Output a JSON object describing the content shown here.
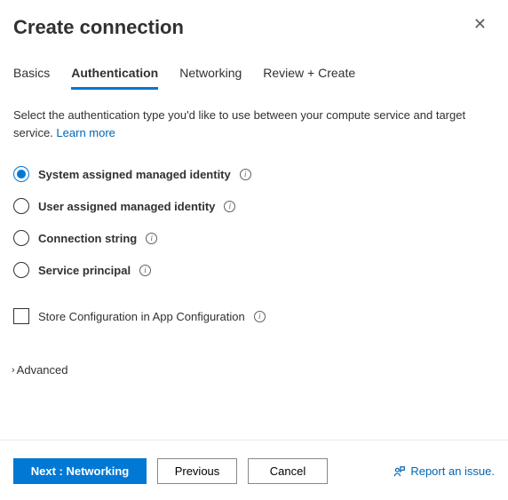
{
  "header": {
    "title": "Create connection"
  },
  "tabs": {
    "items": [
      {
        "label": "Basics"
      },
      {
        "label": "Authentication"
      },
      {
        "label": "Networking"
      },
      {
        "label": "Review + Create"
      }
    ],
    "active_index": 1
  },
  "description": {
    "text": "Select the authentication type you'd like to use between your compute service and target service.",
    "learn_more": "Learn more"
  },
  "auth_options": [
    {
      "label": "System assigned managed identity",
      "selected": true
    },
    {
      "label": "User assigned managed identity",
      "selected": false
    },
    {
      "label": "Connection string",
      "selected": false
    },
    {
      "label": "Service principal",
      "selected": false
    }
  ],
  "store_config": {
    "label": "Store Configuration in App Configuration",
    "checked": false
  },
  "advanced": {
    "label": "Advanced"
  },
  "footer": {
    "primary": "Next : Networking",
    "previous": "Previous",
    "cancel": "Cancel",
    "report": "Report an issue."
  }
}
